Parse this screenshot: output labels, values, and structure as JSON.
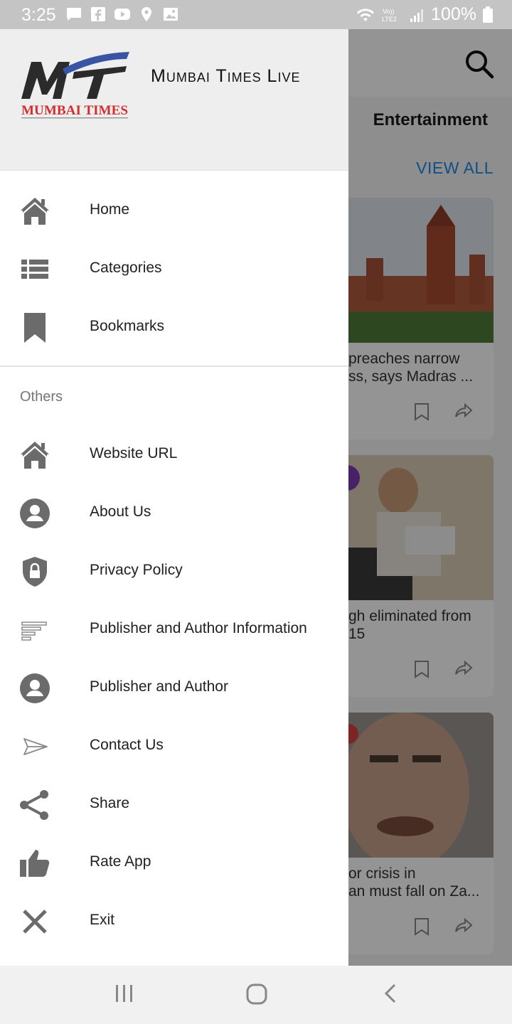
{
  "status_bar": {
    "time": "3:25",
    "battery": "100%",
    "network_label": "VoLTE2",
    "notification_icons": [
      "message-icon",
      "facebook-icon",
      "youtube-icon",
      "location-icon",
      "image-icon"
    ]
  },
  "background_app": {
    "section_title": "Entertainment",
    "view_all": "VIEW ALL",
    "cards": [
      {
        "text_line1": "preaches narrow",
        "text_line2": "ss, says Madras ..."
      },
      {
        "text_line1": "gh eliminated from",
        "text_line2": "15"
      },
      {
        "text_line1": "or crisis in",
        "text_line2": "an must fall on Za..."
      }
    ]
  },
  "drawer": {
    "app_name": "Mumbai Times Live",
    "logo_text": "MUMBAI TIMES",
    "logo_mark": "MT",
    "main_items": [
      {
        "label": "Home",
        "icon": "home-icon"
      },
      {
        "label": "Categories",
        "icon": "list-icon"
      },
      {
        "label": "Bookmarks",
        "icon": "bookmark-icon"
      }
    ],
    "others_heading": "Others",
    "other_items": [
      {
        "label": "Website URL",
        "icon": "home-icon"
      },
      {
        "label": "About Us",
        "icon": "person-icon"
      },
      {
        "label": "Privacy Policy",
        "icon": "shield-lock-icon"
      },
      {
        "label": "Publisher and Author Information",
        "icon": "text-lines-icon"
      },
      {
        "label": "Publisher and Author",
        "icon": "person-icon"
      },
      {
        "label": "Contact Us",
        "icon": "send-icon"
      },
      {
        "label": "Share",
        "icon": "share-icon"
      },
      {
        "label": "Rate App",
        "icon": "thumbs-up-icon"
      },
      {
        "label": "Exit",
        "icon": "close-icon"
      }
    ]
  },
  "colors": {
    "accent_blue": "#1e88e5",
    "logo_red": "#d32f2f",
    "icon_grey": "#6b6b6b"
  }
}
